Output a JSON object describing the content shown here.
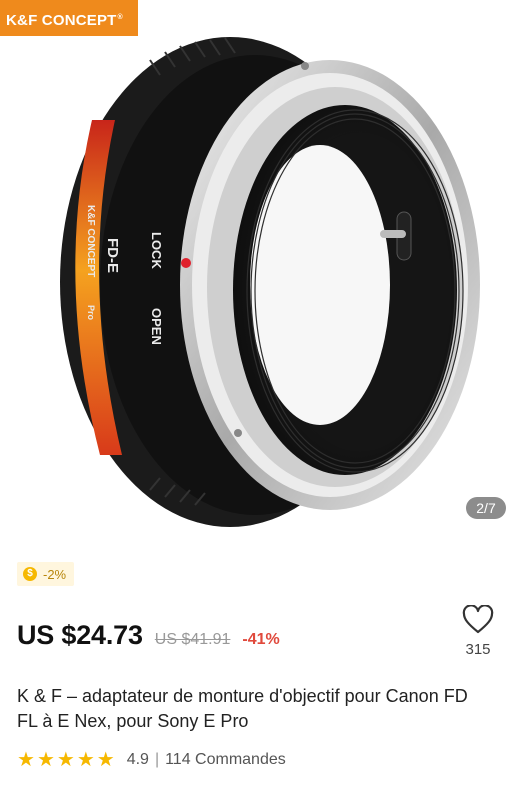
{
  "gallery": {
    "brand_logo": "K&F CONCEPT",
    "indicator": "2/7",
    "lens_text": {
      "model": "FD-E",
      "brand": "K&F CONCEPT",
      "edition": "Pro",
      "lock": "LOCK",
      "open": "OPEN"
    }
  },
  "coupon": {
    "icon": "coin-icon",
    "text": "-2%"
  },
  "price": {
    "current": "US $24.73",
    "original": "US $41.91",
    "discount": "-41%"
  },
  "wishlist": {
    "icon": "heart-outline-icon",
    "count": "315"
  },
  "product": {
    "title": "K & F – adaptateur de monture d'objectif pour Canon FD FL à E Nex, pour Sony E Pro"
  },
  "rating": {
    "stars": 5,
    "value": "4.9",
    "separator": "|",
    "orders": "114 Commandes"
  },
  "colors": {
    "accent": "#ef8a1c",
    "discount": "#e0493c",
    "star": "#f6b800"
  }
}
